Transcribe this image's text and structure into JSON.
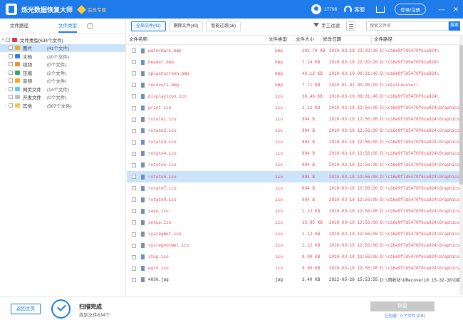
{
  "app": {
    "title": "烁光数据恢复大师",
    "vip_label": "会员专属",
    "user_id": "17796",
    "service_label": "客服",
    "login_label": "登录/注册",
    "win_min": "—",
    "win_close": "✕"
  },
  "left": {
    "tabs": [
      "文件路径",
      "文件类型"
    ],
    "help": "?",
    "tree": [
      {
        "name": "文件类型(634个文件)",
        "count": "",
        "color": "#e0344d",
        "arrow": "▾",
        "indent": 0
      },
      {
        "name": "图片",
        "count": "(41个文件)",
        "color": "#f5a623",
        "arrow": "›",
        "indent": 1,
        "selected": true
      },
      {
        "name": "文档",
        "count": "(10个文件)",
        "color": "#2f80ed",
        "arrow": "›",
        "indent": 1
      },
      {
        "name": "视频",
        "count": "(0个文件)",
        "color": "#f28b30",
        "arrow": "",
        "indent": 1
      },
      {
        "name": "压缩",
        "count": "(2个文件)",
        "color": "#27ae60",
        "arrow": "›",
        "indent": 1
      },
      {
        "name": "音频",
        "count": "(0个文件)",
        "color": "#f5a623",
        "arrow": "",
        "indent": 1
      },
      {
        "name": "网页文件",
        "count": "(14个文件)",
        "color": "#56ccf2",
        "arrow": "›",
        "indent": 1
      },
      {
        "name": "开发文件",
        "count": "(0个文件)",
        "color": "#bdbdbd",
        "arrow": "",
        "indent": 1
      },
      {
        "name": "其他",
        "count": "(567个文件)",
        "color": "#f2c94c",
        "arrow": "›",
        "indent": 1
      }
    ]
  },
  "toolbar": {
    "tabs": [
      "全部文件(41)",
      "删除文件(40)",
      "智能过滤(16)"
    ],
    "filter_label": "手工过滤",
    "search_placeholder": "搜索文件名",
    "search_button": "搜索"
  },
  "table": {
    "headers": [
      "文件名称",
      "文件类型",
      "文件大小",
      "修改日期",
      "文件路径"
    ],
    "rows": [
      {
        "name": "watermark.bmp",
        "type": "bmp",
        "size": "301.78 KB",
        "date": "2010-03-18 22:33:26",
        "path": "D:\\c16e9f7d5470f6ca924\\",
        "red": true
      },
      {
        "name": "header.bmp",
        "type": "bmp",
        "size": "7.14 KB",
        "date": "2010-03-18 22:33:26",
        "path": "D:\\c16e9f7d5470f6ca924\\",
        "red": true
      },
      {
        "name": "splashscreen.bmp",
        "type": "bmp",
        "size": "40.12 KB",
        "date": "2010-03-19 09:31:40",
        "path": "D:\\c16e9f7d5470f6ca924\\",
        "red": true
      },
      {
        "name": "recover1.bmp",
        "type": "bmp",
        "size": "7.71 KB",
        "date": "2020-01-01 00:00:00",
        "path": "D:\\diskrecover\\",
        "red": true
      },
      {
        "name": "displayicon.ico",
        "type": "ico",
        "size": "36.46 KB",
        "date": "2010-03-19 09:31:40",
        "path": "D:\\c16e9f7d5470f6ca924\\",
        "red": true
      },
      {
        "name": "print.ico",
        "type": "ico",
        "size": "1.12 KB",
        "date": "2010-03-18 12:56:08",
        "path": "D:\\c16e9f7d5470f6ca924\\Graphics\\",
        "red": true
      },
      {
        "name": "rotate1.ico",
        "type": "ico",
        "size": "894 B",
        "date": "2010-03-18 12:56:08",
        "path": "D:\\c16e9f7d5470f6ca924\\Graphics\\",
        "red": true
      },
      {
        "name": "rotate2.ico",
        "type": "ico",
        "size": "894 B",
        "date": "2010-03-18 12:56:08",
        "path": "D:\\c16e9f7d5470f6ca924\\Graphics\\",
        "red": true
      },
      {
        "name": "rotate3.ico",
        "type": "ico",
        "size": "894 B",
        "date": "2010-03-18 12:56:08",
        "path": "D:\\c16e9f7d5470f6ca924\\Graphics\\",
        "red": true
      },
      {
        "name": "rotate4.ico",
        "type": "ico",
        "size": "894 B",
        "date": "2010-03-18 12:56:08",
        "path": "D:\\c16e9f7d5470f6ca924\\Graphics\\",
        "red": true
      },
      {
        "name": "rotate5.ico",
        "type": "ico",
        "size": "894 B",
        "date": "2010-03-18 12:56:08",
        "path": "D:\\c16e9f7d5470f6ca924\\Graphics\\",
        "red": true
      },
      {
        "name": "rotate6.ico",
        "type": "ico",
        "size": "894 B",
        "date": "2010-03-18 12:56:08",
        "path": "D:\\c16e9f7d5470f6ca924\\Graphics\\",
        "red": true,
        "selected": true
      },
      {
        "name": "rotate7.ico",
        "type": "ico",
        "size": "894 B",
        "date": "2010-03-18 12:56:08",
        "path": "D:\\c16e9f7d5470f6ca924\\Graphics\\",
        "red": true
      },
      {
        "name": "rotate8.ico",
        "type": "ico",
        "size": "894 B",
        "date": "2010-03-18 12:56:08",
        "path": "D:\\c16e9f7d5470f6ca924\\Graphics\\",
        "red": true
      },
      {
        "name": "save.ico",
        "type": "ico",
        "size": "1.12 KB",
        "date": "2010-03-18 12:56:08",
        "path": "D:\\c16e9f7d5470f6ca924\\Graphics\\",
        "red": true
      },
      {
        "name": "setup.ico",
        "type": "ico",
        "size": "35.85 KB",
        "date": "2010-03-18 12:56:08",
        "path": "D:\\c16e9f7d5470f6ca924\\Graphics\\",
        "red": true
      },
      {
        "name": "sysreqmet.ico",
        "type": "ico",
        "size": "1.12 KB",
        "date": "2010-03-18 12:56:08",
        "path": "D:\\c16e9f7d5470f6ca924\\Graphics\\",
        "red": true
      },
      {
        "name": "sysreqnotmet.ico",
        "type": "ico",
        "size": "1.12 KB",
        "date": "2010-03-18 12:56:08",
        "path": "D:\\c16e9f7d5470f6ca924\\Graphics\\",
        "red": true
      },
      {
        "name": "stop.ico",
        "type": "ico",
        "size": "9.90 KB",
        "date": "2010-03-18 12:56:08",
        "path": "D:\\c16e9f7d5470f6ca924\\Graphics\\",
        "red": true
      },
      {
        "name": "warn.ico",
        "type": "ico",
        "size": "9.90 KB",
        "date": "2010-03-18 12:56:08",
        "path": "D:\\c16e9f7d5470f6ca924\\Graphics\\",
        "red": true
      },
      {
        "name": "4030.jpg",
        "type": "jpg",
        "size": "3.40 KB",
        "date": "2022-05-26 15:53:55",
        "path": "D:\\回收站\\DRecover10 15-32-30\\D盘\\d",
        "red": false
      }
    ]
  },
  "bottom": {
    "home_button": "返回主页",
    "scan_title": "扫描完成",
    "scan_sub": "找到文件634个",
    "recover_button": "恢复",
    "selected_info": "已勾选：0 个文件 (0 B)"
  }
}
